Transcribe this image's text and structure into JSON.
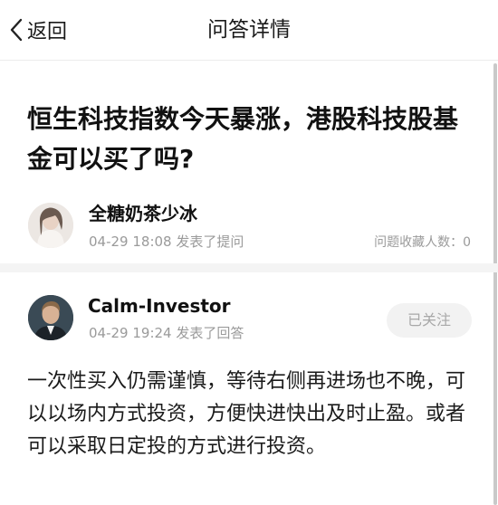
{
  "nav": {
    "back_label": "返回",
    "title": "问答详情"
  },
  "question": {
    "title": "恒生科技指数今天暴涨，港股科技股基金可以买了吗?",
    "asker": {
      "name": "全糖奶茶少冰",
      "meta": "04-29 18:08 发表了提问"
    },
    "favorites": "问题收藏人数：0"
  },
  "answer": {
    "author": {
      "name": "Calm-Investor",
      "meta": "04-29 19:24 发表了回答"
    },
    "follow_label": "已关注",
    "body": "一次性买入仍需谨慎，等待右侧再进场也不晚，可以以场内方式投资，方便快进快出及时止盈。或者可以采取日定投的方式进行投资。"
  },
  "icons": {
    "back": "chevron-left-icon"
  },
  "colors": {
    "meta_text": "#9a9a9a",
    "divider": "#f4f4f4",
    "follow_bg": "#f2f2f2"
  }
}
